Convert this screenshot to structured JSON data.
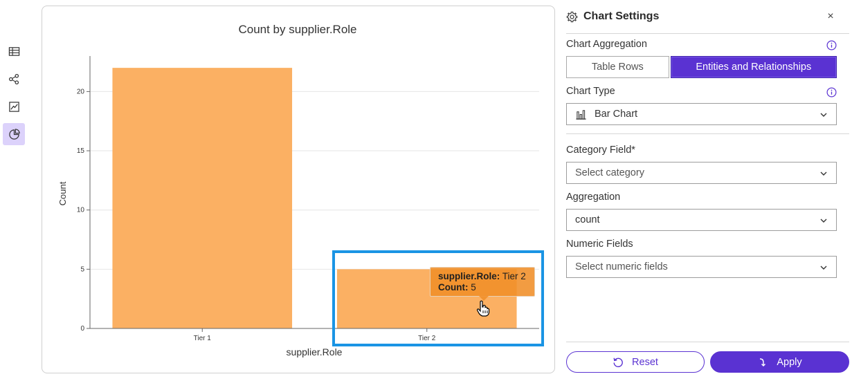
{
  "rail": {
    "items": [
      {
        "icon": "table-icon",
        "active": false
      },
      {
        "icon": "graph-nodes-icon",
        "active": false
      },
      {
        "icon": "line-chart-icon",
        "active": false
      },
      {
        "icon": "pie-chart-icon",
        "active": true
      }
    ]
  },
  "chart_data": {
    "type": "bar",
    "title": "Count by supplier.Role",
    "xlabel": "supplier.Role",
    "ylabel": "Count",
    "categories": [
      "Tier 1",
      "Tier 2"
    ],
    "values": [
      22,
      5
    ],
    "ylim": [
      0,
      23
    ],
    "yticks": [
      0,
      5,
      10,
      15,
      20
    ],
    "bar_color": "#fbb063",
    "grid": true,
    "tooltip": {
      "field_label": "supplier.Role:",
      "field_value": "Tier 2",
      "count_label": "Count:",
      "count_value": "5"
    }
  },
  "panel": {
    "title": "Chart Settings",
    "close": "×",
    "aggregation_label": "Chart Aggregation",
    "aggregation_options": [
      "Table Rows",
      "Entities and Relationships"
    ],
    "aggregation_selected": "Entities and Relationships",
    "chart_type_label": "Chart Type",
    "chart_type_value": "Bar Chart",
    "category_label": "Category Field*",
    "category_placeholder": "Select category",
    "agg_label": "Aggregation",
    "agg_value": "count",
    "numeric_label": "Numeric Fields",
    "numeric_placeholder": "Select numeric fields",
    "reset_label": "Reset",
    "apply_label": "Apply"
  },
  "colors": {
    "accent": "#5a32d2",
    "bar": "#fbb063",
    "highlight": "#1a94e4"
  }
}
